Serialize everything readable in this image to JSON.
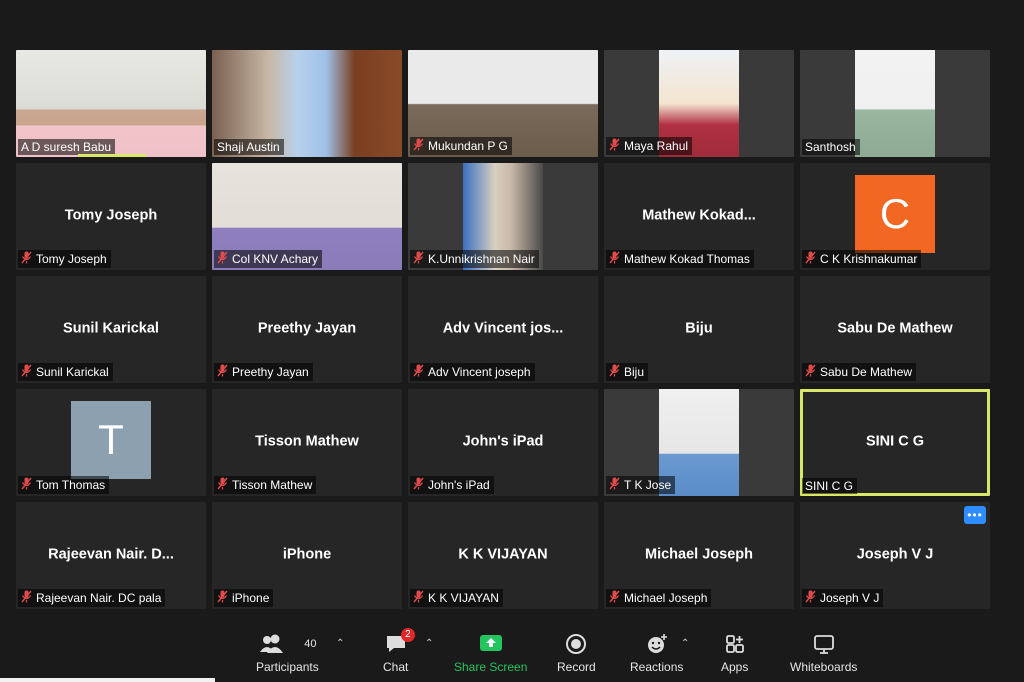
{
  "participants": [
    {
      "name": "A D suresh Babu",
      "display": "A D suresh Babu",
      "type": "video",
      "muted": false,
      "speaking": true
    },
    {
      "name": "Shaji Austin",
      "display": "Shaji Austin",
      "type": "video",
      "muted": false
    },
    {
      "name": "Mukundan P G",
      "display": "Mukundan P G",
      "type": "video",
      "muted": true
    },
    {
      "name": "Maya Rahul",
      "display": "Maya Rahul",
      "type": "video",
      "muted": true,
      "narrow": true
    },
    {
      "name": "Santhosh",
      "display": "Santhosh",
      "type": "video",
      "muted": false,
      "narrow": true
    },
    {
      "name": "Tomy Joseph",
      "display": "Tomy Joseph",
      "type": "name",
      "muted": true
    },
    {
      "name": "Col KNV Achary",
      "display": "Col KNV Achary",
      "type": "video",
      "muted": true
    },
    {
      "name": "K.Unnikrishnan Nair",
      "display": "K.Unnikrishnan Nair",
      "type": "video",
      "muted": true,
      "narrow": true
    },
    {
      "name": "Mathew Kokad Thomas",
      "display": "Mathew  Kokad...",
      "type": "name",
      "muted": true
    },
    {
      "name": "C K Krishnakumar",
      "display": "",
      "type": "avatar",
      "letter": "C",
      "avatar_color": "#f26722",
      "muted": true
    },
    {
      "name": "Sunil Karickal",
      "display": "Sunil Karickal",
      "type": "name",
      "muted": true
    },
    {
      "name": "Preethy Jayan",
      "display": "Preethy Jayan",
      "type": "name",
      "muted": true
    },
    {
      "name": "Adv Vincent joseph",
      "display": "Adv Vincent jos...",
      "type": "name",
      "muted": true
    },
    {
      "name": "Biju",
      "display": "Biju",
      "type": "name",
      "muted": true
    },
    {
      "name": "Sabu De Mathew",
      "display": "Sabu De Mathew",
      "type": "name",
      "muted": true
    },
    {
      "name": "Tom Thomas",
      "display": "",
      "type": "avatar",
      "letter": "T",
      "avatar_color": "#8ca0b0",
      "muted": true
    },
    {
      "name": "Tisson Mathew",
      "display": "Tisson Mathew",
      "type": "name",
      "muted": true
    },
    {
      "name": "John's iPad",
      "display": "John's iPad",
      "type": "name",
      "muted": true
    },
    {
      "name": "T K Jose",
      "display": "T K Jose",
      "type": "video",
      "muted": true,
      "narrow": true
    },
    {
      "name": "SINI C G",
      "display": "SINI C G",
      "type": "name",
      "muted": false,
      "highlight": true
    },
    {
      "name": "Rajeevan Nair. DC pala",
      "display": "Rajeevan Nair. D...",
      "type": "name",
      "muted": true
    },
    {
      "name": "iPhone",
      "display": "iPhone",
      "type": "name",
      "muted": true
    },
    {
      "name": "K K VIJAYAN",
      "display": "K K VIJAYAN",
      "type": "name",
      "muted": true
    },
    {
      "name": "Michael Joseph",
      "display": "Michael Joseph",
      "type": "name",
      "muted": true
    },
    {
      "name": "Joseph V J",
      "display": "Joseph V J",
      "type": "name",
      "muted": true,
      "more": true
    }
  ],
  "toolbar": {
    "participants_label": "Participants",
    "participants_count": "40",
    "chat_label": "Chat",
    "chat_badge": "2",
    "share_label": "Share Screen",
    "record_label": "Record",
    "reactions_label": "Reactions",
    "apps_label": "Apps",
    "whiteboards_label": "Whiteboards"
  },
  "colors": {
    "accent_green": "#22c55e",
    "highlight": "#d6e866",
    "muted_red": "#e02828",
    "more_blue": "#2d8cff"
  }
}
